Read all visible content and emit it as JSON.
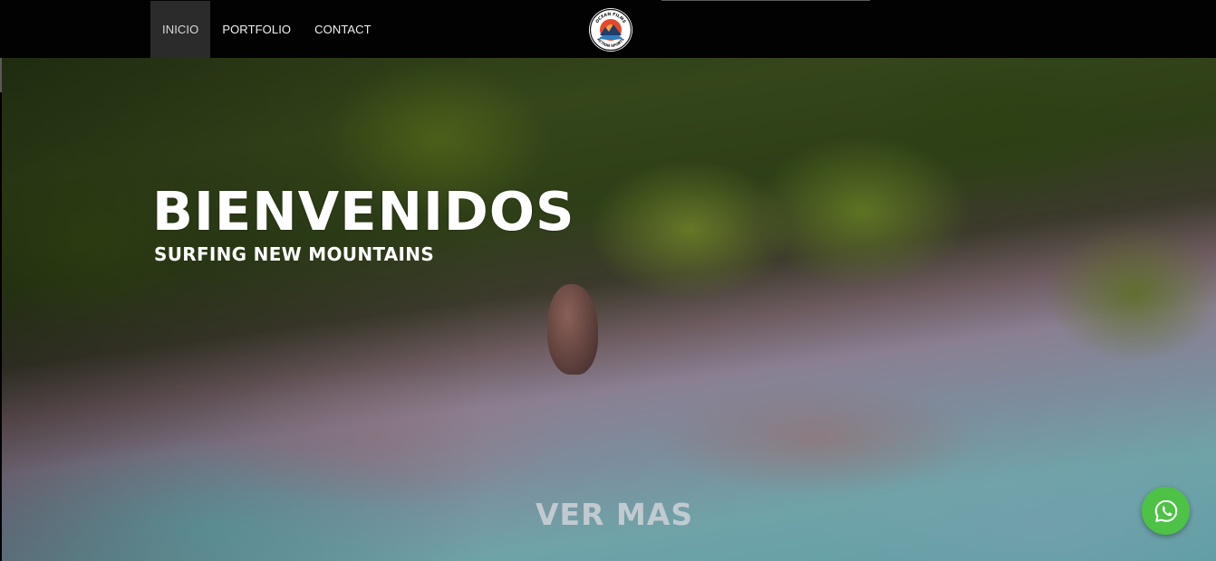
{
  "nav": {
    "items": [
      {
        "label": "INICIO",
        "active": true
      },
      {
        "label": "PORTFOLIO",
        "active": false
      },
      {
        "label": "CONTACT",
        "active": false
      }
    ]
  },
  "logo": {
    "top_text": "OCEAN FILMS",
    "bottom_text": "ACTION SPORTS",
    "icon": "mountain-sun-badge-icon"
  },
  "hero": {
    "title": "BIENVENIDOS",
    "subtitle": "SURFING NEW MOUNTAINS",
    "cta_label": "VER MAS"
  },
  "whatsapp": {
    "icon": "whatsapp-icon"
  },
  "colors": {
    "topbar": "#020202",
    "active_nav": "#2b2b2b",
    "whatsapp_green": "#4dc247",
    "hero_text": "#ffffff"
  }
}
